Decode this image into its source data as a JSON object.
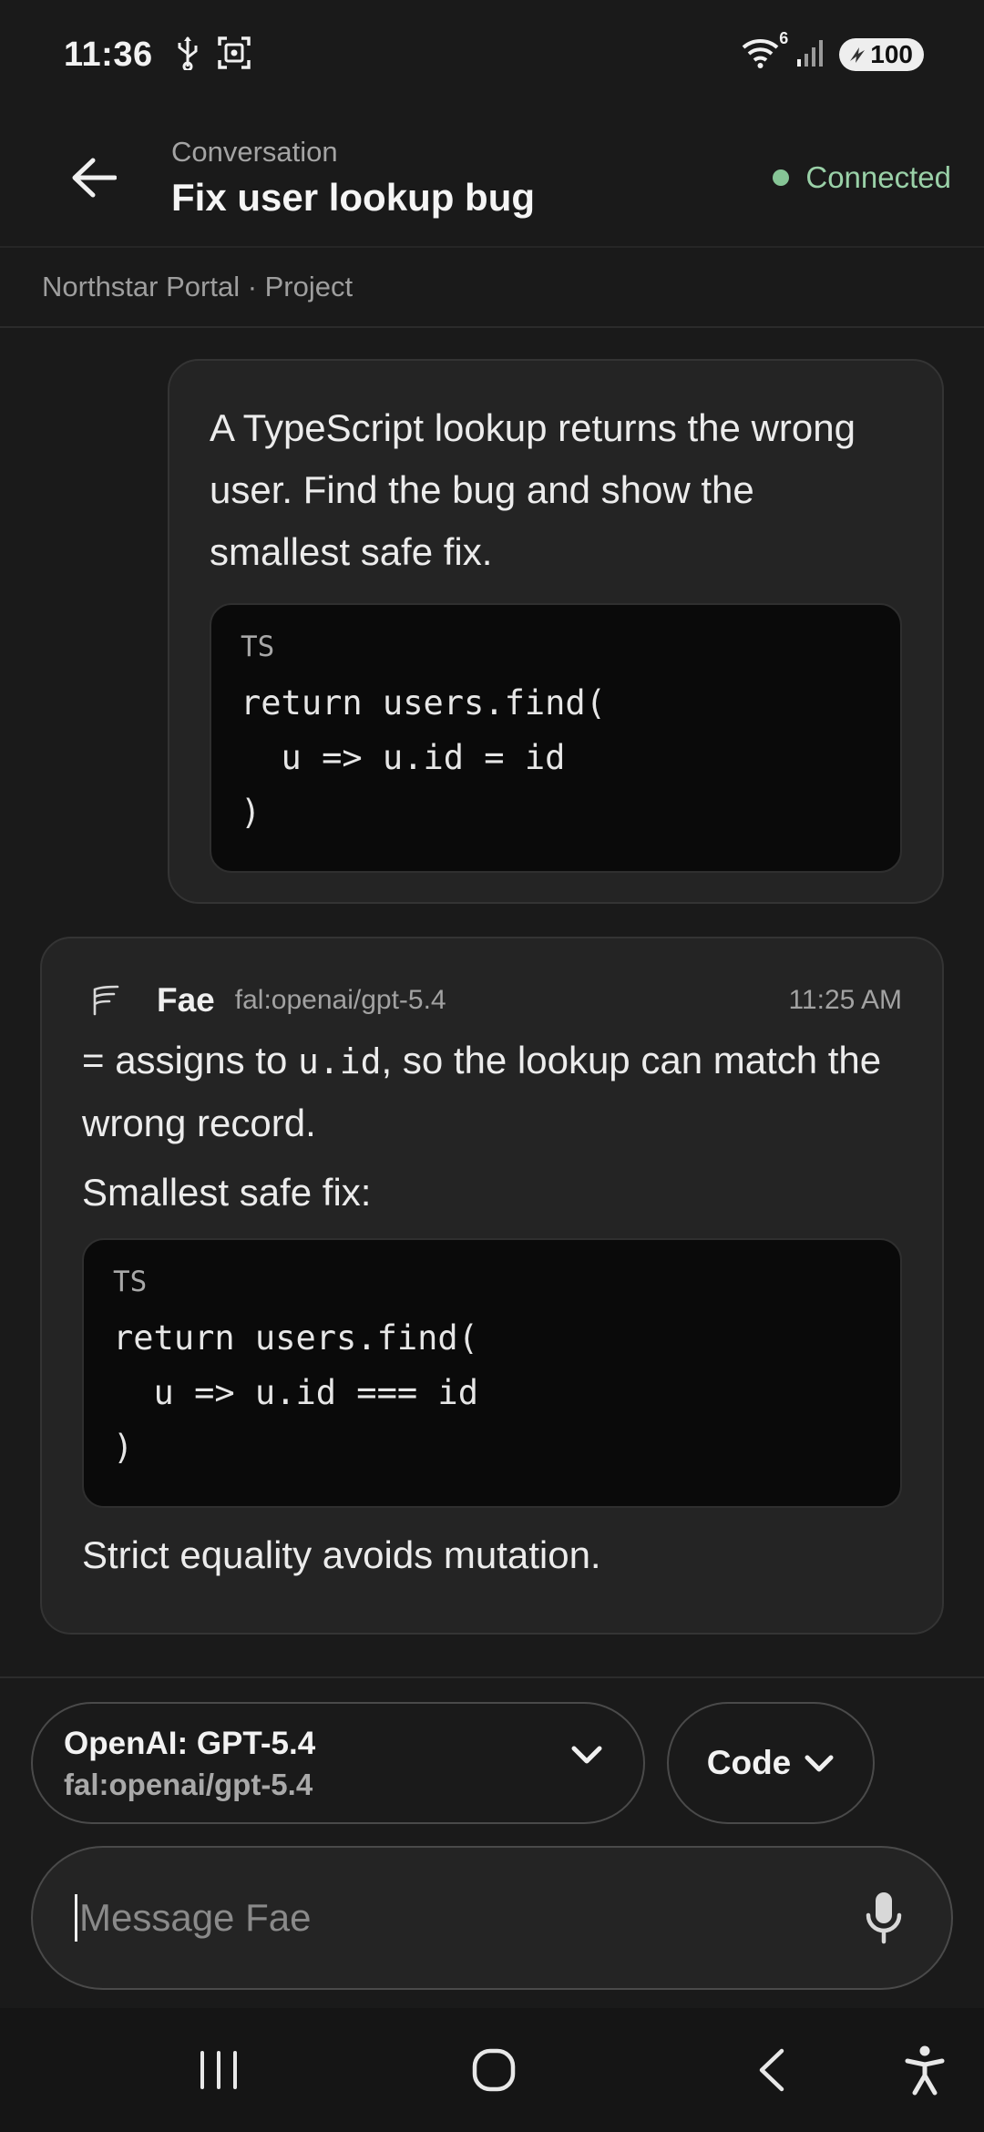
{
  "status_bar": {
    "time": "11:36",
    "network": "6",
    "battery": "100",
    "icons": [
      "usb-icon",
      "screenshot-icon",
      "wifi-icon",
      "signal-icon",
      "battery-icon"
    ]
  },
  "header": {
    "subtitle": "Conversation",
    "title": "Fix user lookup bug",
    "status": "Connected",
    "status_color": "#86c596"
  },
  "breadcrumb": "Northstar Portal · Project",
  "messages": {
    "user": {
      "text": "A TypeScript lookup returns the wrong user. Find the bug and show the smallest safe fix.",
      "code": {
        "lang": "TS",
        "lines": [
          "return users.find(",
          "  u => u.id = id",
          ")"
        ]
      }
    },
    "assistant": {
      "name": "Fae",
      "model": "fal:openai/gpt-5.4",
      "time": "11:25 AM",
      "line1_pre": "= assigns to ",
      "line1_code": "u.id",
      "line1_post": ", so the lookup can match the wrong record.",
      "line2": "Smallest safe fix:",
      "code": {
        "lang": "TS",
        "lines": [
          "return users.find(",
          "  u => u.id === id",
          ")"
        ]
      },
      "footer": "Strict equality avoids mutation."
    }
  },
  "composer": {
    "model_name": "OpenAI: GPT-5.4",
    "model_id": "fal:openai/gpt-5.4",
    "mode": "Code",
    "placeholder": "Message Fae"
  },
  "nav": [
    "recents-icon",
    "home-icon",
    "back-icon",
    "accessibility-icon"
  ]
}
